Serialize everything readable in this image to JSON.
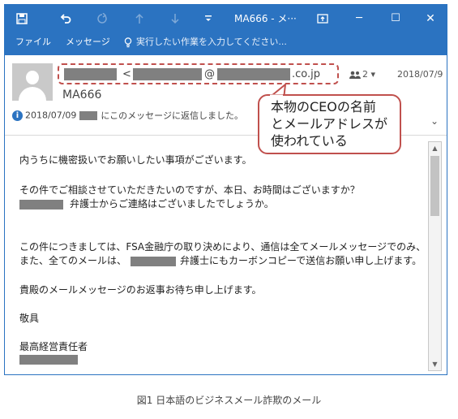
{
  "titlebar": {
    "save_icon": "save-icon",
    "undo_icon": "undo-icon",
    "redo_icon": "redo-icon",
    "up_icon": "arrow-up-icon",
    "down_icon": "arrow-down-icon",
    "customize_icon": "customize-qat-icon",
    "title": "MA666 - メ···",
    "ribbon_display_icon": "ribbon-display-options-icon",
    "minimize_glyph": "─",
    "maximize_glyph": "☐",
    "close_glyph": "✕"
  },
  "ribbon": {
    "tabs": [
      {
        "label": "ファイル"
      },
      {
        "label": "メッセージ"
      }
    ],
    "tell_me": "実行したい作業を入力してください..."
  },
  "message_header": {
    "sender_lt": "<",
    "sender_at": "@",
    "sender_domain": ".co.jp",
    "people_count": "2",
    "people_dropdown": "▾",
    "date": "2018/07/9",
    "subject": "MA666",
    "info_date": "2018/07/09",
    "info_text": "にこのメッセージに返信しました。",
    "expand_glyph": "⌄"
  },
  "callout": {
    "lines": [
      "本物のCEOの名前",
      "とメールアドレスが",
      "使われている"
    ],
    "border_color": "#c0504d"
  },
  "body": {
    "line1": "内うちに機密扱いでお願いしたい事項がございます。",
    "line2": "その件でご相談させていただきたいのですが、本日、お時間はございますか？",
    "line3": "弁護士からご連絡はございましたでしょうか。",
    "line4": "この件につきましては、FSA金融庁の取り決めにより、通信は全てメールメッセージでのみ、",
    "line5a": "また、全てのメールは、",
    "line5b": "弁護士にもカーボンコピーで送信お願い申し上げます。",
    "line6": "貴殿のメールメッセージのお返事お待ち申し上げます。",
    "line7": "敬具",
    "line8": "最高経営責任者"
  },
  "scrollbar": {
    "up_glyph": "▲",
    "down_glyph": "▼"
  },
  "caption": "図1 日本語のビジネスメール詐欺のメール",
  "colors": {
    "accent": "#2b73c1",
    "redaction": "#808080",
    "highlight": "#c0504d"
  }
}
